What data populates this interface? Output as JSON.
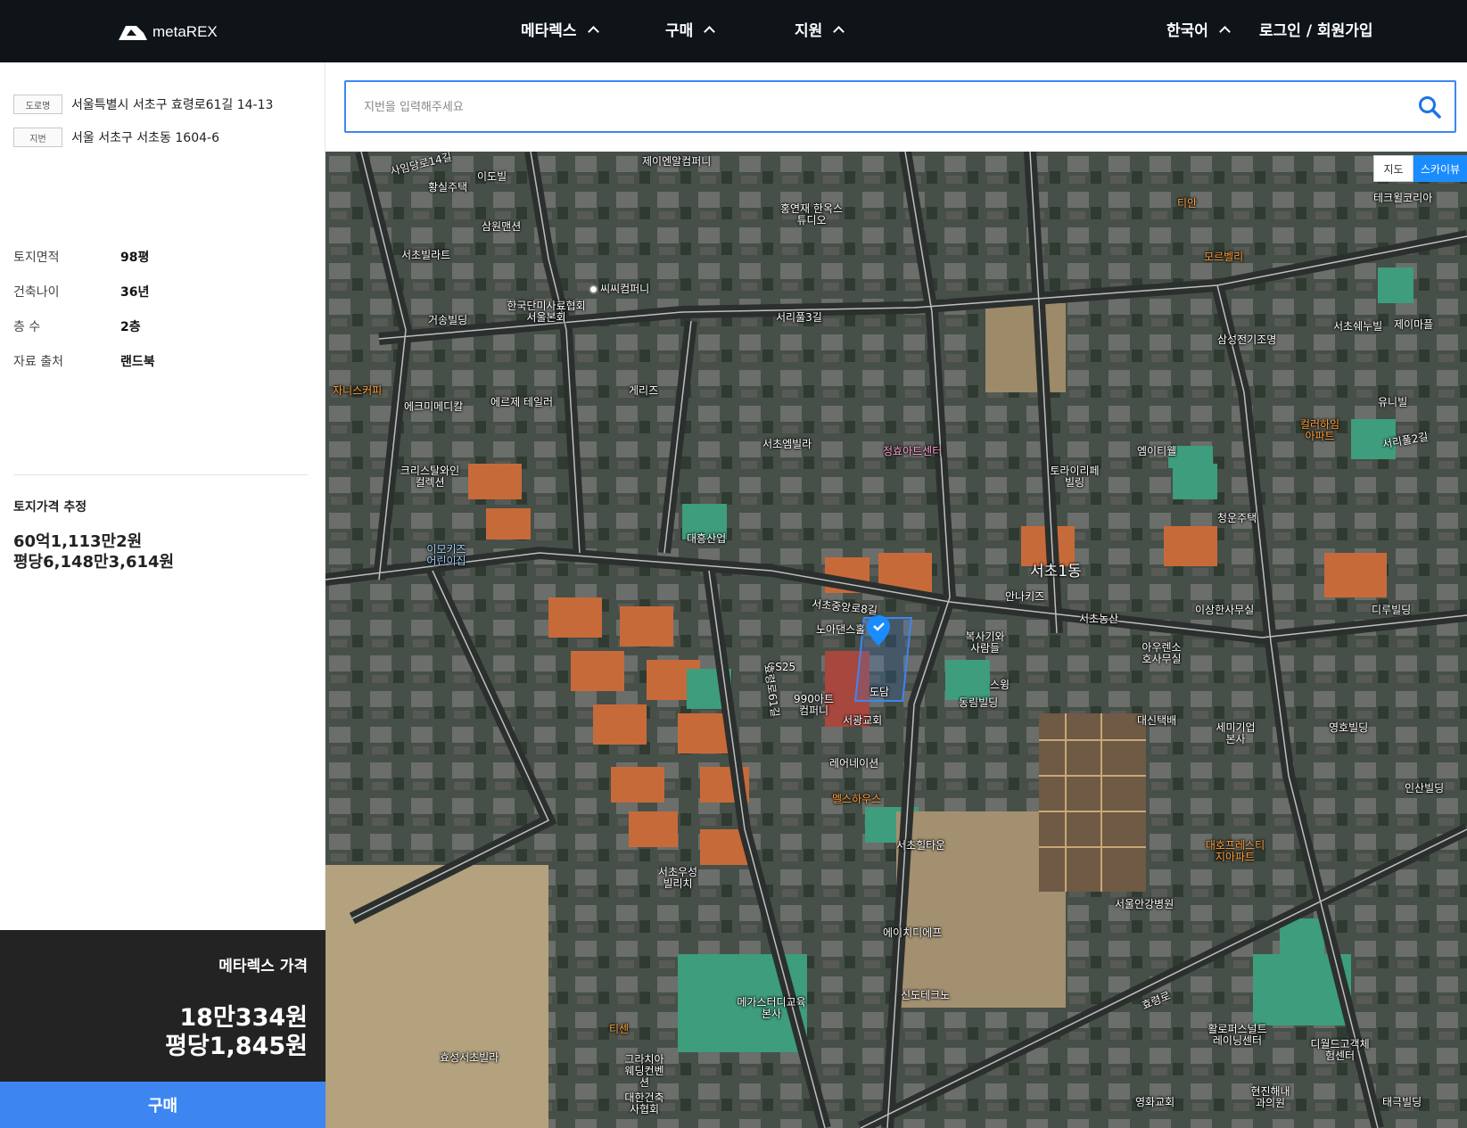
{
  "header": {
    "brand": "metaREX",
    "nav": [
      {
        "label": "메타렉스"
      },
      {
        "label": "구매"
      },
      {
        "label": "지원"
      }
    ],
    "language": "한국어",
    "auth": "로그인 / 회원가입"
  },
  "sidebar": {
    "address": {
      "road_tag": "도로명",
      "road": "서울특별시 서초구 효령로61길 14-13",
      "lot_tag": "지번",
      "lot": "서울 서초구 서초동 1604-6"
    },
    "info": [
      {
        "key": "토지면적",
        "value": "98평"
      },
      {
        "key": "건축나이",
        "value": "36년"
      },
      {
        "key": "층 수",
        "value": "2층"
      },
      {
        "key": "자료 출처",
        "value": "랜드북"
      }
    ],
    "estimate": {
      "title": "토지가격 추정",
      "total": "60억1,113만2원",
      "per_pyeong": "평당6,148만3,614원"
    },
    "metarex": {
      "label": "메타렉스 가격",
      "total": "18만334원",
      "per_pyeong": "평당1,845원"
    },
    "buy_label": "구매"
  },
  "search": {
    "placeholder": "지번을 입력해주세요"
  },
  "map": {
    "toggle_map": "지도",
    "toggle_sky": "스카이뷰",
    "labels": [
      {
        "text": "사임당로14길"
      },
      {
        "text": "이도빌"
      },
      {
        "text": "황실주택"
      },
      {
        "text": "제이엔알컴퍼니"
      },
      {
        "text": "홍연재 한옥스튜디오"
      },
      {
        "text": "티안"
      },
      {
        "text": "테크윌코리아"
      },
      {
        "text": "삼원맨션"
      },
      {
        "text": "서초빌라트"
      },
      {
        "text": "씨씨컴퍼니"
      },
      {
        "text": "한국단미사료협회 서울본회"
      },
      {
        "text": "모르벨리"
      },
      {
        "text": "거송빌딩"
      },
      {
        "text": "서리풀3길"
      },
      {
        "text": "삼성전기조명"
      },
      {
        "text": "서초쉐누빌"
      },
      {
        "text": "제이마플"
      },
      {
        "text": "자니스커피"
      },
      {
        "text": "에크미메디칼"
      },
      {
        "text": "에르제 테일러"
      },
      {
        "text": "게리즈"
      },
      {
        "text": "유니빌"
      },
      {
        "text": "컬러하임아파트"
      },
      {
        "text": "서초엠빌라"
      },
      {
        "text": "정효아트센터"
      },
      {
        "text": "엠이티웰"
      },
      {
        "text": "토라이리페빌링"
      },
      {
        "text": "크리스탈와인컬렉션"
      },
      {
        "text": "대흥산업"
      },
      {
        "text": "청운주택"
      },
      {
        "text": "이모키즈어린이집"
      },
      {
        "text": "서초1동"
      },
      {
        "text": "안나키즈"
      },
      {
        "text": "서초중앙로8길"
      },
      {
        "text": "서초농산"
      },
      {
        "text": "이상한사무실"
      },
      {
        "text": "디루빌딩"
      },
      {
        "text": "노아댄스홀"
      },
      {
        "text": "복사기와사람들"
      },
      {
        "text": "아우렌소호사무실"
      },
      {
        "text": "GS25"
      },
      {
        "text": "990아트컴퍼니"
      },
      {
        "text": "서광교회"
      },
      {
        "text": "도담"
      },
      {
        "text": "스윙"
      },
      {
        "text": "동림빌딩"
      },
      {
        "text": "대신택배"
      },
      {
        "text": "세미기업본사"
      },
      {
        "text": "영호빌딩"
      },
      {
        "text": "레어네이션"
      },
      {
        "text": "멜스하우스"
      },
      {
        "text": "인산빌딩"
      },
      {
        "text": "서초힐타운"
      },
      {
        "text": "대호프레스티지아파트"
      },
      {
        "text": "서초우성빌리치"
      },
      {
        "text": "서울안강병원"
      },
      {
        "text": "에이치디에프"
      },
      {
        "text": "신도테크노"
      },
      {
        "text": "메가스터디교육본사"
      },
      {
        "text": "효성서초빌라"
      },
      {
        "text": "티센"
      },
      {
        "text": "그라치아웨딩컨벤션"
      },
      {
        "text": "대한건축사협회"
      },
      {
        "text": "효령로"
      },
      {
        "text": "활로퍼스널트레이닝센터"
      },
      {
        "text": "디월드고객체험센터"
      },
      {
        "text": "영화교회"
      },
      {
        "text": "현진해내과의원"
      },
      {
        "text": "태극빌딩"
      },
      {
        "text": "효령로61길"
      },
      {
        "text": "서리풀2길"
      }
    ]
  }
}
